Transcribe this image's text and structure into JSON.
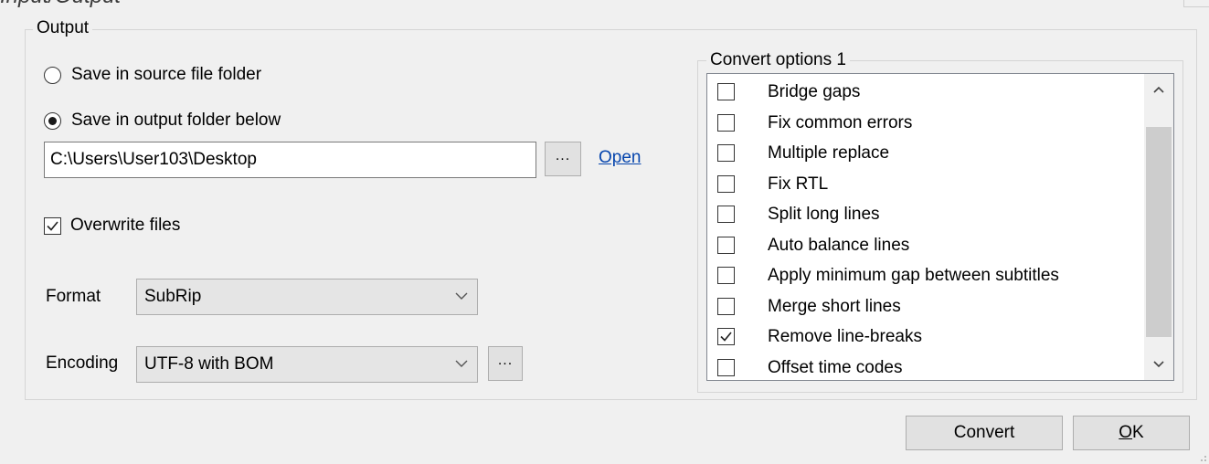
{
  "clipped_header_text": "Input/Output",
  "output_group": {
    "legend": "Output",
    "save_in_source_label": "Save in source file folder",
    "save_in_source_selected": false,
    "save_in_output_label": "Save in output folder below",
    "save_in_output_selected": true,
    "folder_path": "C:\\Users\\User103\\Desktop",
    "browse_label": "...",
    "open_link": "Open",
    "overwrite_label": "Overwrite files",
    "overwrite_checked": true,
    "format_label": "Format",
    "format_value": "SubRip",
    "encoding_label": "Encoding",
    "encoding_value": "UTF-8 with BOM",
    "encoding_more_label": "..."
  },
  "convert_options": {
    "legend": "Convert options  1",
    "items": [
      {
        "label": "Bridge gaps",
        "checked": false
      },
      {
        "label": "Fix common errors",
        "checked": false
      },
      {
        "label": "Multiple replace",
        "checked": false
      },
      {
        "label": "Fix RTL",
        "checked": false
      },
      {
        "label": "Split long lines",
        "checked": false
      },
      {
        "label": "Auto balance lines",
        "checked": false
      },
      {
        "label": "Apply minimum gap between subtitles",
        "checked": false
      },
      {
        "label": "Merge short lines",
        "checked": false
      },
      {
        "label": "Remove line-breaks",
        "checked": true
      },
      {
        "label": "Offset time codes",
        "checked": false
      }
    ]
  },
  "buttons": {
    "convert_label": "Convert",
    "ok_underlined_letter": "O",
    "ok_rest": "K"
  },
  "colors": {
    "background": "#f0f0f0",
    "link": "#0645ad",
    "button_face": "#e1e1e1"
  }
}
